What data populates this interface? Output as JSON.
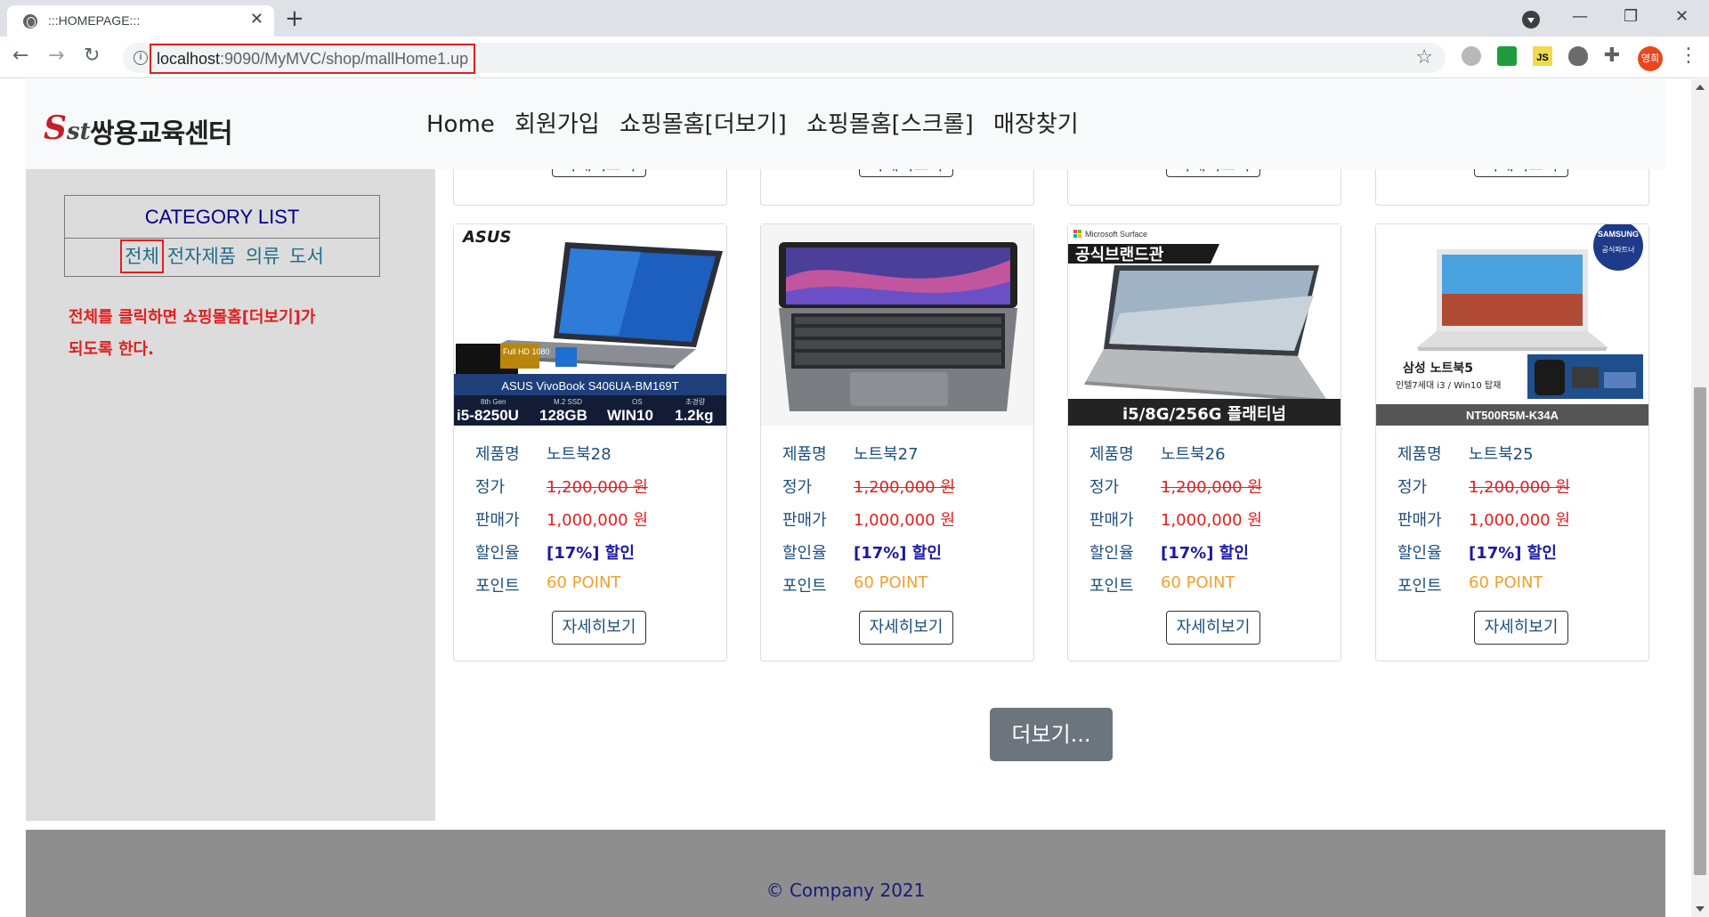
{
  "browser": {
    "tab_title": ":::HOMEPAGE:::",
    "tab_close": "✕",
    "new_tab": "+",
    "url_host": "localhost",
    "url_rest": ":9090/MyMVC/shop/mallHome1.up",
    "avatar_label": "영희",
    "ext_js_label": "JS",
    "win_min": "—",
    "win_max": "❐",
    "win_close": "✕",
    "back": "←",
    "forward": "→",
    "reload": "↻",
    "star": "☆",
    "kebab": "⋮",
    "puzzle": "✚",
    "info": "i"
  },
  "header": {
    "logo_mark": "S",
    "logo_mark_small": "st",
    "logo_text": "쌍용교육센터",
    "nav": [
      "Home",
      "회원가입",
      "쇼핑몰홈[더보기]",
      "쇼핑몰홈[스크롤]",
      "매장찾기"
    ]
  },
  "sidebar": {
    "title": "CATEGORY LIST",
    "items": [
      "전체",
      "전자제품",
      "의류",
      "도서"
    ],
    "note_line1": "전체를 클릭하면 쇼핑몰홈[더보기]가",
    "note_line2": "되도록 한다."
  },
  "labels": {
    "name": "제품명",
    "price": "정가",
    "sale": "판매가",
    "rate": "할인율",
    "point": "포인트",
    "detail": "자세히보기"
  },
  "products": [
    {
      "name": "노트북28",
      "price": "1,200,000 원",
      "sale": "1,000,000 원",
      "rate": "[17%] 할인",
      "point": "60 POINT",
      "img": {
        "brand": "ASUS",
        "model": "ASUS VivoBook S406UA-BM169T",
        "specs": [
          "i5-8250U",
          "128GB",
          "WIN10",
          "1.2kg"
        ],
        "badge": "Full HD 1080",
        "spec_heads": [
          "8th Gen",
          "M.2 SSD",
          "OS",
          "초경량"
        ]
      }
    },
    {
      "name": "노트북27",
      "price": "1,200,000 원",
      "sale": "1,000,000 원",
      "rate": "[17%] 할인",
      "point": "60 POINT"
    },
    {
      "name": "노트북26",
      "price": "1,200,000 원",
      "sale": "1,000,000 원",
      "rate": "[17%] 할인",
      "point": "60 POINT",
      "img": {
        "brand": "Microsoft Surface",
        "banner": "공식브랜드관",
        "bottom": "i5/8G/256G 플래티넘"
      }
    },
    {
      "name": "노트북25",
      "price": "1,200,000 원",
      "sale": "1,000,000 원",
      "rate": "[17%] 할인",
      "point": "60 POINT",
      "img": {
        "brand": "SAMSUNG",
        "badge": "공식파트너",
        "title": "삼성 노트북5",
        "sub": "인텔7세대 i3 / Win10 탑재",
        "bottom": "NT500R5M-K34A"
      }
    }
  ],
  "more_button": "더보기...",
  "footer": "© Company 2021",
  "colors": {
    "accent_red": "#e02020",
    "navy": "#00008b",
    "sidebar_bg": "#dcdcdc",
    "footer_bg": "#8e8e8e",
    "more_btn": "#6c757d",
    "point": "#f0a030"
  }
}
